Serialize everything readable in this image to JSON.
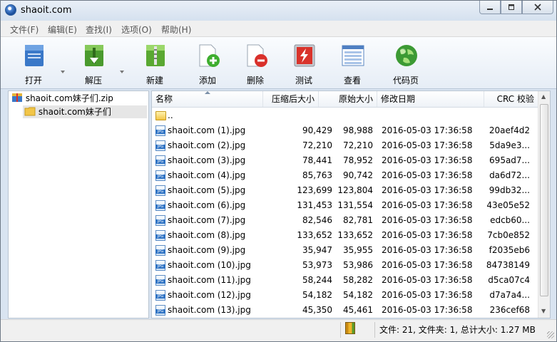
{
  "window": {
    "title": "shaoit.com"
  },
  "menu": [
    {
      "label": "文件(F)"
    },
    {
      "label": "编辑(E)"
    },
    {
      "label": "查找(I)"
    },
    {
      "label": "选项(O)"
    },
    {
      "label": "帮助(H)"
    }
  ],
  "toolbar": [
    {
      "label": "打开",
      "icon": "open-archive-icon"
    },
    {
      "label": "解压",
      "icon": "extract-icon"
    },
    {
      "label": "新建",
      "icon": "new-archive-icon"
    },
    {
      "label": "添加",
      "icon": "add-icon"
    },
    {
      "label": "删除",
      "icon": "delete-icon"
    },
    {
      "label": "测试",
      "icon": "test-icon"
    },
    {
      "label": "查看",
      "icon": "view-icon"
    },
    {
      "label": "代码页",
      "icon": "codepage-globe-icon"
    }
  ],
  "tree": {
    "root": "shaoit.com妹子们.zip",
    "child": "shaoit.com妹子们"
  },
  "columns": {
    "name": "名称",
    "compressed": "压缩后大小",
    "original": "原始大小",
    "modified": "修改日期",
    "crc": "CRC 校验"
  },
  "parent_row": "..",
  "files": [
    {
      "name": "shaoit.com (1).jpg",
      "compressed": "90,429",
      "original": "98,988",
      "modified": "2016-05-03 17:36:58",
      "crc": "20aef4d2"
    },
    {
      "name": "shaoit.com (2).jpg",
      "compressed": "72,210",
      "original": "72,210",
      "modified": "2016-05-03 17:36:58",
      "crc": "5da9e3..."
    },
    {
      "name": "shaoit.com (3).jpg",
      "compressed": "78,441",
      "original": "78,952",
      "modified": "2016-05-03 17:36:58",
      "crc": "695ad7..."
    },
    {
      "name": "shaoit.com (4).jpg",
      "compressed": "85,763",
      "original": "90,742",
      "modified": "2016-05-03 17:36:58",
      "crc": "da6d72..."
    },
    {
      "name": "shaoit.com (5).jpg",
      "compressed": "123,699",
      "original": "123,804",
      "modified": "2016-05-03 17:36:58",
      "crc": "99db32..."
    },
    {
      "name": "shaoit.com (6).jpg",
      "compressed": "131,453",
      "original": "131,554",
      "modified": "2016-05-03 17:36:58",
      "crc": "43e05e52"
    },
    {
      "name": "shaoit.com (7).jpg",
      "compressed": "82,546",
      "original": "82,781",
      "modified": "2016-05-03 17:36:58",
      "crc": "edcb60..."
    },
    {
      "name": "shaoit.com (8).jpg",
      "compressed": "133,652",
      "original": "133,652",
      "modified": "2016-05-03 17:36:58",
      "crc": "7cb0e852"
    },
    {
      "name": "shaoit.com (9).jpg",
      "compressed": "35,947",
      "original": "35,955",
      "modified": "2016-05-03 17:36:58",
      "crc": "f2035eb6"
    },
    {
      "name": "shaoit.com (10).jpg",
      "compressed": "53,973",
      "original": "53,986",
      "modified": "2016-05-03 17:36:58",
      "crc": "84738149"
    },
    {
      "name": "shaoit.com (11).jpg",
      "compressed": "58,244",
      "original": "58,282",
      "modified": "2016-05-03 17:36:58",
      "crc": "d5ca07c4"
    },
    {
      "name": "shaoit.com (12).jpg",
      "compressed": "54,182",
      "original": "54,182",
      "modified": "2016-05-03 17:36:58",
      "crc": "d7a7a4..."
    },
    {
      "name": "shaoit.com (13).jpg",
      "compressed": "45,350",
      "original": "45,461",
      "modified": "2016-05-03 17:36:58",
      "crc": "236cef68"
    }
  ],
  "status": {
    "text": "文件: 21, 文件夹: 1, 总计大小: 1.27 MB"
  },
  "colors": {
    "toolbar_bg": "#e6edf6",
    "window_frame": "#d9e4f1"
  }
}
